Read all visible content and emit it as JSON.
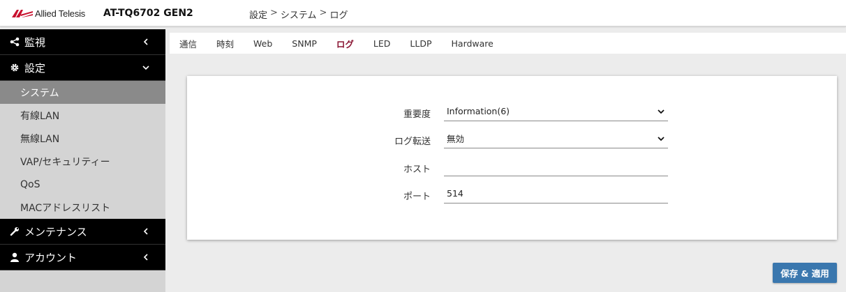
{
  "header": {
    "brand": "Allied Telesis",
    "model": "AT-TQ6702 GEN2",
    "breadcrumb": [
      "設定",
      "システム",
      "ログ"
    ],
    "breadcrumb_separator": ">"
  },
  "sidebar": {
    "sections": [
      {
        "label": "監視",
        "icon": "share-icon",
        "expanded": false
      },
      {
        "label": "設定",
        "icon": "gear-icon",
        "expanded": true
      },
      {
        "label": "メンテナンス",
        "icon": "wrench-icon",
        "expanded": false
      },
      {
        "label": "アカウント",
        "icon": "user-icon",
        "expanded": false
      }
    ],
    "items": [
      {
        "label": "システム",
        "active": true
      },
      {
        "label": "有線LAN",
        "active": false
      },
      {
        "label": "無線LAN",
        "active": false
      },
      {
        "label": "VAP/セキュリティー",
        "active": false
      },
      {
        "label": "QoS",
        "active": false
      },
      {
        "label": "MACアドレスリスト",
        "active": false
      }
    ]
  },
  "tabs": [
    {
      "label": "通信",
      "active": false
    },
    {
      "label": "時刻",
      "active": false
    },
    {
      "label": "Web",
      "active": false
    },
    {
      "label": "SNMP",
      "active": false
    },
    {
      "label": "ログ",
      "active": true
    },
    {
      "label": "LED",
      "active": false
    },
    {
      "label": "LLDP",
      "active": false
    },
    {
      "label": "Hardware",
      "active": false
    }
  ],
  "form": {
    "severity": {
      "label": "重要度",
      "value": "Information(6)"
    },
    "log_forward": {
      "label": "ログ転送",
      "value": "無効"
    },
    "host": {
      "label": "ホスト",
      "value": ""
    },
    "port": {
      "label": "ポート",
      "value": "514"
    }
  },
  "save_button": {
    "label": "保存 & 適用"
  },
  "colors": {
    "sidebar_header": "#000000",
    "sidebar_bg": "#d4d4d4",
    "sidebar_active": "#8a8a8a",
    "active_tab": "#8a1533",
    "button": "#3a77ae",
    "background": "#ececec"
  }
}
